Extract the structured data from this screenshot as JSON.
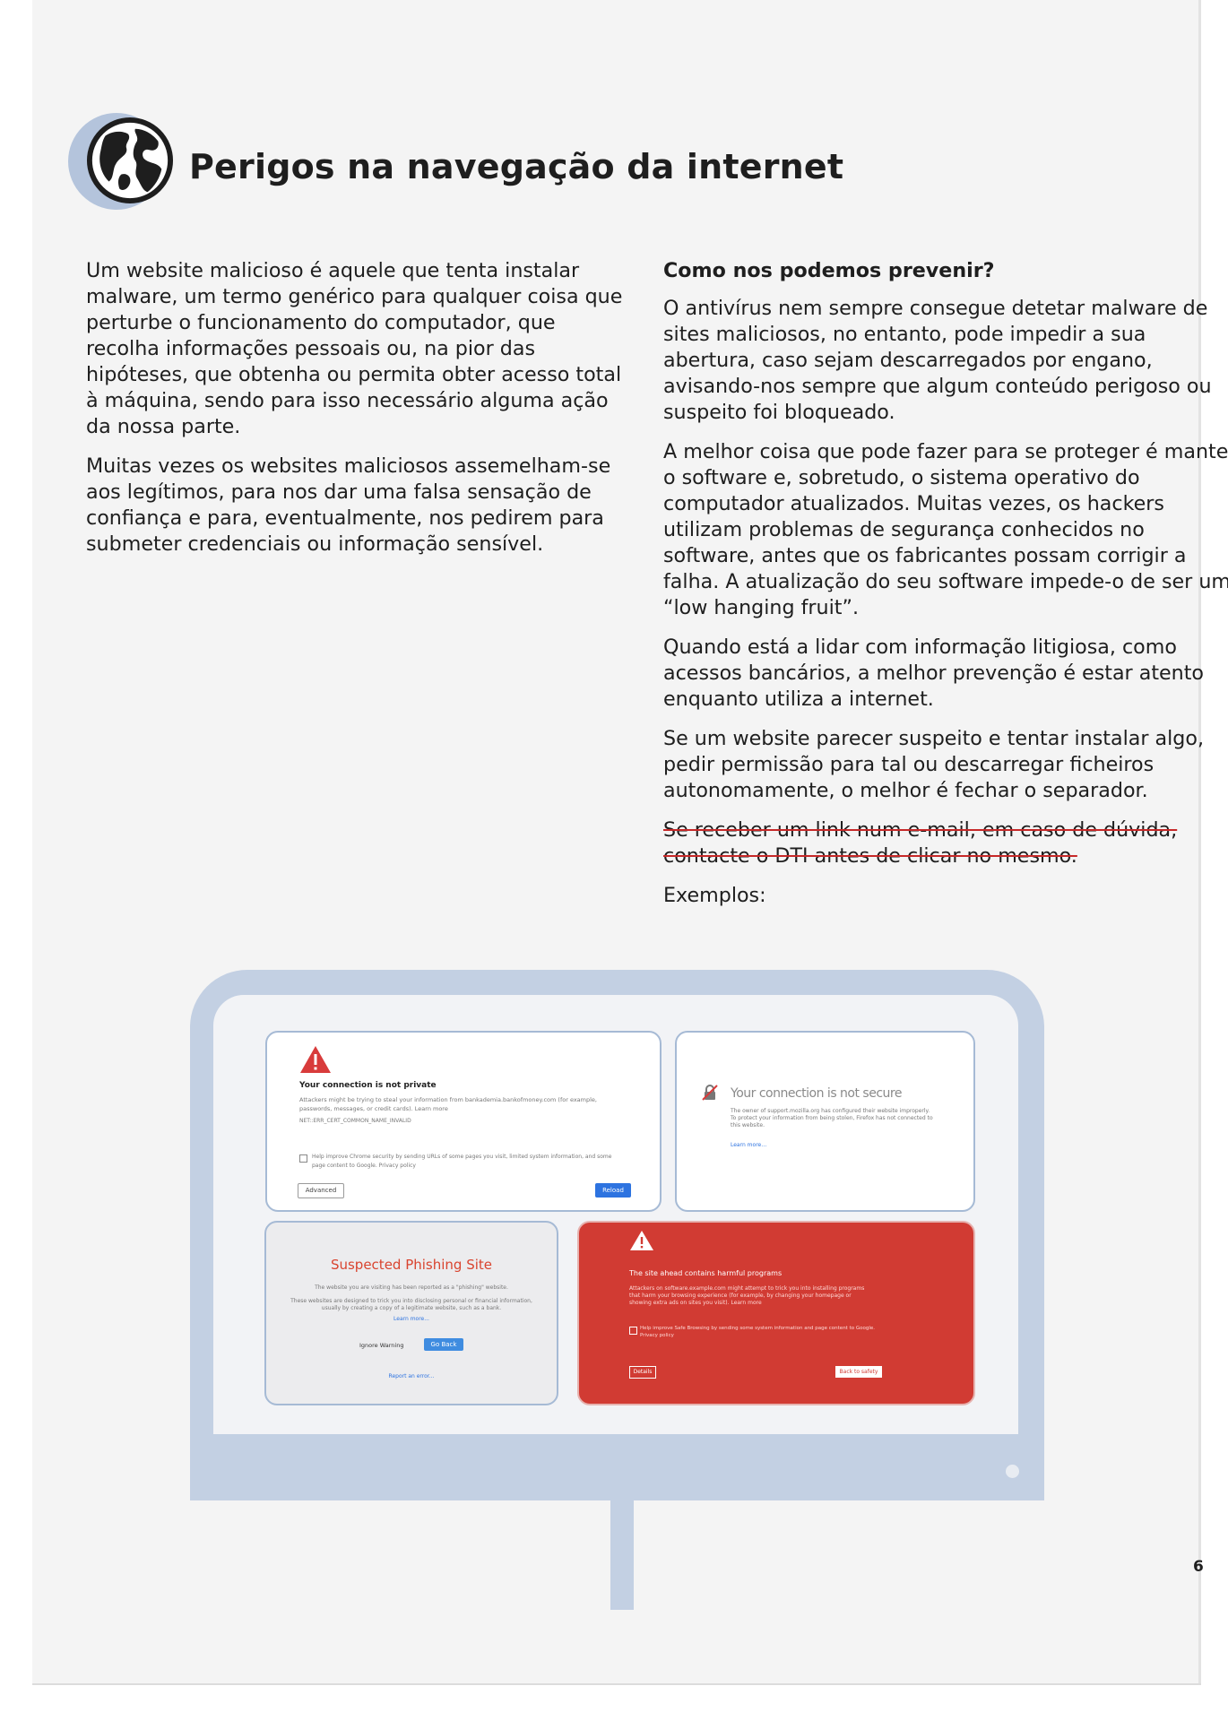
{
  "page": {
    "title": "Perigos na navegação da internet",
    "page_number": "6",
    "icon": "globe-icon"
  },
  "left_column": {
    "paragraphs": [
      "Um website malicioso é aquele que tenta instalar malware, um termo genérico para qualquer coisa que perturbe o funcionamento do computador, que recolha informações pessoais ou, na pior das hipóteses, que obtenha ou permita obter acesso total à máquina, sendo para isso necessário alguma ação da nossa parte.",
      "Muitas vezes os websites maliciosos assemelham-se aos legítimos, para nos dar uma falsa sensação de confiança e para, eventualmente, nos pedirem para submeter credenciais ou informação sensível."
    ]
  },
  "right_column": {
    "heading": "Como nos podemos prevenir?",
    "paragraphs": [
      "O antivírus nem sempre consegue detetar malware de sites maliciosos, no entanto, pode impedir a sua abertura, caso sejam descarregados por engano, avisando-nos sempre que algum conteúdo perigoso ou suspeito foi bloqueado.",
      "A melhor coisa que pode fazer para se proteger é manter o software e, sobretudo, o sistema operativo do computador atualizados. Muitas vezes, os hackers utilizam problemas de segurança conhecidos no software, antes que os fabricantes possam corrigir a falha. A atualização do seu software impede-o de ser um “low hanging fruit”.",
      "Quando está a lidar com informação litigiosa, como acessos bancários, a melhor prevenção é estar atento enquanto utiliza a internet.",
      "Se um website parecer suspeito e tentar instalar algo, pedir permissão para tal ou descarregar ficheiros autonomamente, o melhor é fechar o separador."
    ],
    "struck_paragraph": "Se receber um link num e-mail, em caso de dúvida, contacte o DTI antes de clicar no mesmo.",
    "examples_label": "Exemplos:"
  },
  "illustration": {
    "chrome_warning": {
      "heading": "Your connection is not private",
      "body": "Attackers might be trying to steal your information from bankademia.bankofmoney.com (for example, passwords, messages, or credit cards). Learn more",
      "error_code": "NET::ERR_CERT_COMMON_NAME_INVALID",
      "checkbox_text": "Help improve Chrome security by sending URLs of some pages you visit, limited system information, and some page content to Google. Privacy policy",
      "advanced_button": "Advanced",
      "reload_button": "Reload",
      "accent_color": "#d83b3b"
    },
    "firefox_warning": {
      "heading": "Your connection is not secure",
      "body": "The owner of support.mozilla.org has configured their website improperly. To protect your information from being stolen, Firefox has not connected to this website.",
      "link": "Learn more…",
      "icon": "broken-lock-icon"
    },
    "phishing_warning": {
      "heading": "Suspected Phishing Site",
      "line1": "The website you are visiting has been reported as a \"phishing\" website.",
      "line2": "These websites are designed to trick you into disclosing personal or financial information, usually by creating a copy of a legitimate website, such as a bank.",
      "learn_more": "Learn more...",
      "ignore_button": "Ignore Warning",
      "back_button": "Go Back",
      "report_link": "Report an error...",
      "heading_color": "#d9442f"
    },
    "harmful_warning": {
      "heading": "The site ahead contains harmful programs",
      "body": "Attackers on software.example.com might attempt to trick you into installing programs that harm your browsing experience (for example, by changing your homepage or showing extra ads on sites you visit). Learn more",
      "checkbox_text": "Help improve Safe Browsing by sending some system information and page content to Google. Privacy policy",
      "details_button": "Details",
      "back_button": "Back to safety",
      "background_color": "#d13b33"
    }
  }
}
